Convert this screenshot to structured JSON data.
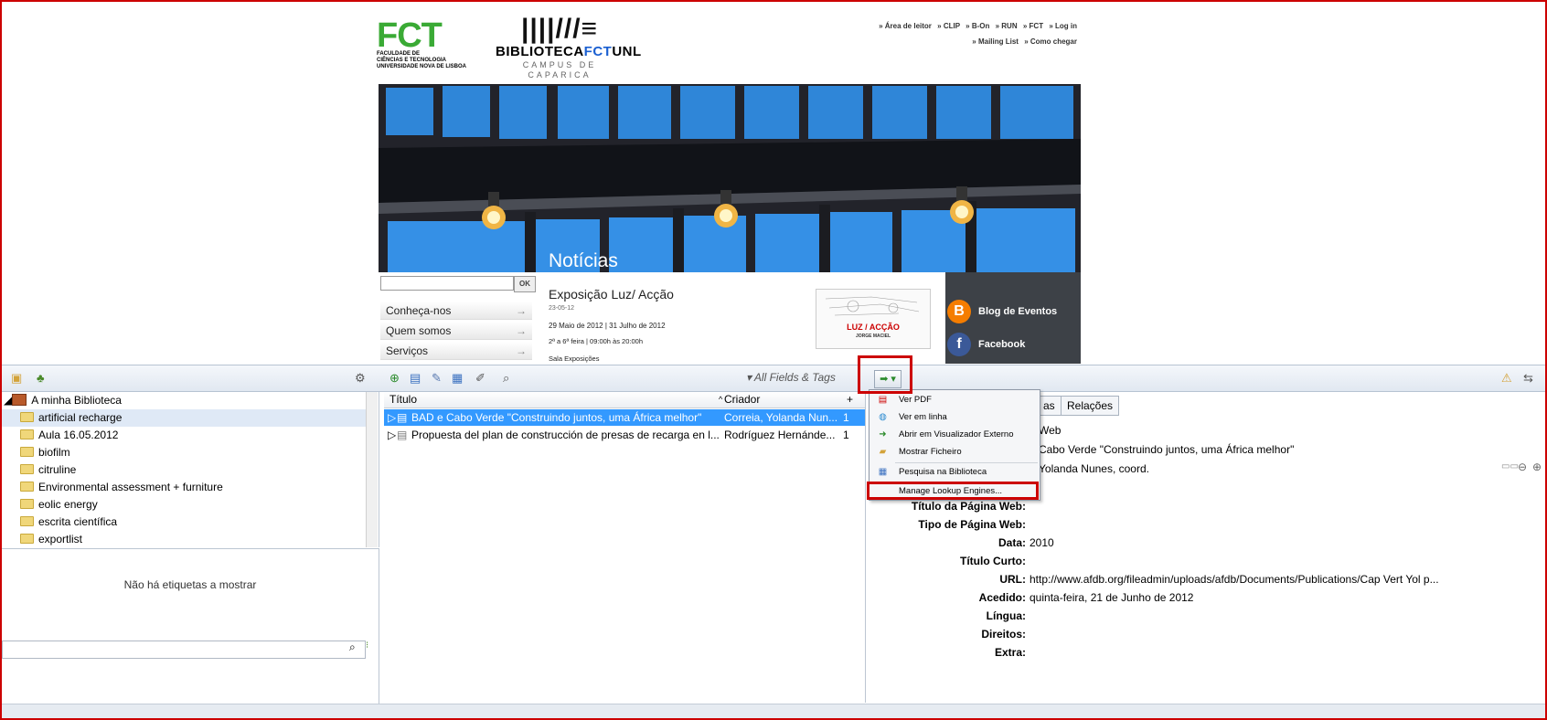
{
  "site": {
    "fct_logo_text": "FCT",
    "fct_logo_sub": [
      "FACULDADE DE",
      "CIÊNCIAS E TECNOLOGIA",
      "UNIVERSIDADE NOVA DE LISBOA"
    ],
    "bib_logo_bars": "||||///≡",
    "bib_logo_title_a": "BIBLIOTECA",
    "bib_logo_title_b": "FCT",
    "bib_logo_title_c": "UNL",
    "bib_logo_sub": "CAMPUS DE CAPARICA",
    "toplinks_row1": [
      "» Área de leitor",
      "» CLIP",
      "» B-On",
      "» RUN",
      "» FCT",
      "» Log in"
    ],
    "toplinks_row2": [
      "» Mailing List",
      "» Como chegar"
    ],
    "noticias": "Notícias",
    "search_ok": "OK",
    "nav": [
      "Conheça-nos",
      "Quem somos",
      "Serviços"
    ],
    "nav_arrow": "→",
    "news": {
      "title": "Exposição Luz/ Acção",
      "date": "23-05-12",
      "line1": "29 Maio de 2012 | 31 Julho de 2012",
      "line2": "2ª a 6ª feira | 09:00h às 20:00h",
      "line3": "Sala Exposições",
      "poster_title": "LUZ / ACÇÃO",
      "poster_sub": "JORGE MACIEL"
    },
    "social": [
      "Blog de Eventos",
      "Facebook"
    ]
  },
  "zotero": {
    "search_placeholder": "All Fields & Tags",
    "collections": [
      "A minha Biblioteca",
      "artificial recharge",
      "Aula 16.05.2012",
      "biofilm",
      "citruline",
      "Environmental assessment + furniture",
      "eolic energy",
      "escrita científica",
      "exportlist"
    ],
    "tags_empty": "Não há etiquetas a mostrar",
    "columns": {
      "title": "Título",
      "creator": "Criador",
      "plus": "+"
    },
    "items": [
      {
        "title": "BAD e Cabo Verde \"Construindo juntos,  uma África melhor\"",
        "creator": "Correia, Yolanda Nun...",
        "count": "1"
      },
      {
        "title": "Propuesta del plan de construcción de presas de recarga en l...",
        "creator": "Rodríguez Hernánde...",
        "count": "1"
      }
    ],
    "menu": [
      {
        "label": "Ver PDF",
        "icon": "pdf-icon"
      },
      {
        "label": "Ver em linha",
        "icon": "globe-icon"
      },
      {
        "label": "Abrir em Visualizador Externo",
        "icon": "external-viewer-icon"
      },
      {
        "label": "Mostrar Ficheiro",
        "icon": "folder-icon"
      },
      {
        "label": "Pesquisa na Biblioteca",
        "icon": "library-search-icon"
      },
      {
        "label": "Manage Lookup Engines...",
        "icon": ""
      }
    ],
    "tabs": [
      "as",
      "Relações"
    ],
    "details_top": [
      "Web",
      "Cabo Verde \"Construindo juntos, uma África melhor\"",
      "Yolanda Nunes, coord."
    ],
    "fields": [
      {
        "label": "Título da Página Web:",
        "value": ""
      },
      {
        "label": "Tipo de Página Web:",
        "value": ""
      },
      {
        "label": "Data:",
        "value": "2010"
      },
      {
        "label": "Título Curto:",
        "value": ""
      },
      {
        "label": "URL:",
        "value": "http://www.afdb.org/fileadmin/uploads/afdb/Documents/Publications/Cap Vert Yol p..."
      },
      {
        "label": "Acedido:",
        "value": "quinta-feira, 21 de Junho de 2012"
      },
      {
        "label": "Língua:",
        "value": ""
      },
      {
        "label": "Direitos:",
        "value": ""
      },
      {
        "label": "Extra:",
        "value": ""
      }
    ],
    "colors": {
      "selection": "#3399ff",
      "highlight": "#cc0000"
    }
  }
}
